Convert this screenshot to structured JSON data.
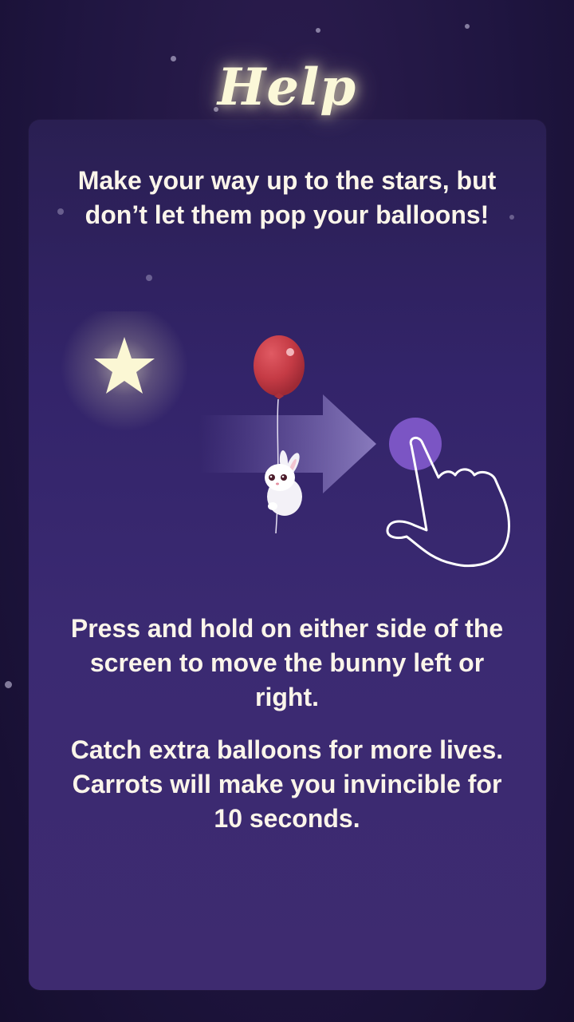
{
  "screen": {
    "title": "Help",
    "intro_text": "Make your way up to the stars, but don’t let them pop your balloons!",
    "instruction_move": "Press and hold on either side of the screen to move the bunny left or right.",
    "instruction_items": "Catch extra balloons for more lives. Carrots will make you invincible for 10 seconds."
  },
  "illustration": {
    "star_icon": "star-icon",
    "balloon_icon": "balloon-icon",
    "bunny_icon": "bunny-icon",
    "arrow_icon": "arrow-right-icon",
    "hand_icon": "hand-pointer-icon"
  },
  "colors": {
    "background": "#1f1540",
    "panel": "#3b2a72",
    "title_glow": "#fbf8d8",
    "text": "#fbf5ea",
    "balloon": "#c73d47",
    "touch_circle": "#7b55c4"
  }
}
